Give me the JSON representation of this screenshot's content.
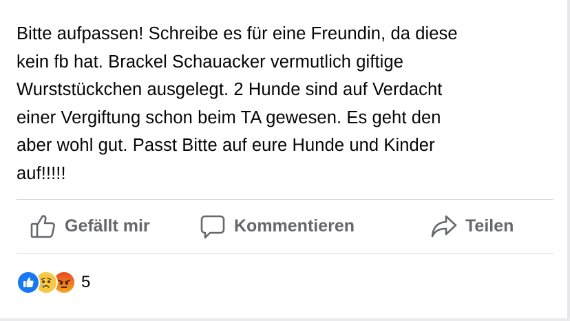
{
  "post": {
    "text": "Bitte aufpassen! Schreibe es für eine Freundin, da diese\nkein fb hat. Brackel Schauacker vermutlich giftige\nWurststückchen ausgelegt. 2 Hunde sind auf Verdacht\neiner Vergiftung schon beim TA gewesen. Es geht den\naber wohl gut. Passt Bitte auf eure Hunde und Kinder\nauf!!!!!"
  },
  "actions": {
    "like_label": "Gefällt mir",
    "comment_label": "Kommentieren",
    "share_label": "Teilen",
    "icons": [
      "thumbs-up-icon",
      "comment-bubble-icon",
      "share-arrow-icon"
    ]
  },
  "reactions": {
    "types": [
      "like",
      "sad",
      "angry"
    ],
    "count": "5"
  },
  "colors": {
    "text": "#050505",
    "action_text": "#65676b",
    "divider": "#d4d6da",
    "like_blue": "#1877f2"
  }
}
